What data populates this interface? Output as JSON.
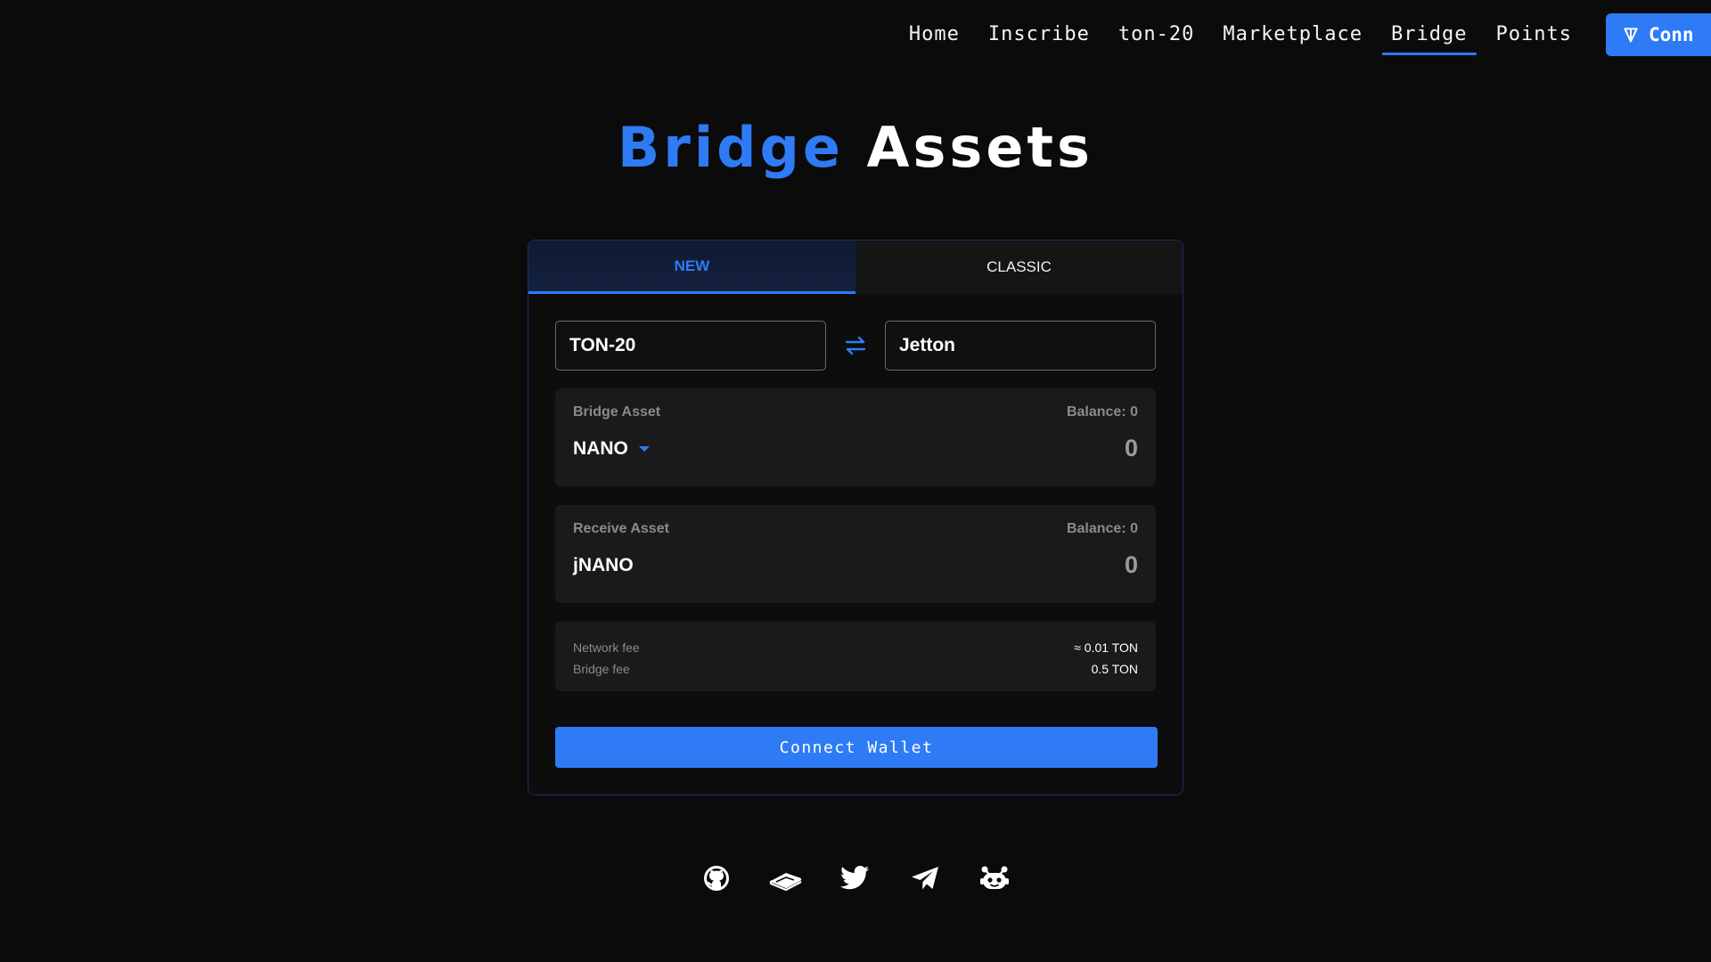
{
  "nav": {
    "links": [
      {
        "label": "Home",
        "active": false
      },
      {
        "label": "Inscribe",
        "active": false
      },
      {
        "label": "ton-20",
        "active": false
      },
      {
        "label": "Marketplace",
        "active": false
      },
      {
        "label": "Bridge",
        "active": true
      },
      {
        "label": "Points",
        "active": false
      }
    ],
    "connect_label": "Conn",
    "connect_icon": "ton-icon"
  },
  "title": {
    "accent": "Bridge",
    "main": "Assets"
  },
  "card": {
    "tabs": [
      {
        "label": "NEW",
        "active": true
      },
      {
        "label": "CLASSIC",
        "active": false
      }
    ],
    "from_type": "TON-20",
    "to_type": "Jetton",
    "swap_icon": "swap-arrows-icon",
    "bridge_asset": {
      "label": "Bridge Asset",
      "balance": "Balance: 0",
      "token": "NANO",
      "amount": "0"
    },
    "receive_asset": {
      "label": "Receive Asset",
      "balance": "Balance: 0",
      "token": "jNANO",
      "amount": "0"
    },
    "fees": {
      "network_label": "Network fee",
      "network_value": "≈ 0.01 TON",
      "bridge_label": "Bridge fee",
      "bridge_value": "0.5 TON"
    },
    "connect_wallet": "Connect Wallet"
  },
  "socials": [
    "github-icon",
    "gitbook-icon",
    "twitter-icon",
    "telegram-icon",
    "discord-bot-icon"
  ],
  "colors": {
    "accent": "#2f7bf5",
    "background": "#0b0b0c",
    "panel": "#1a1a1b"
  }
}
